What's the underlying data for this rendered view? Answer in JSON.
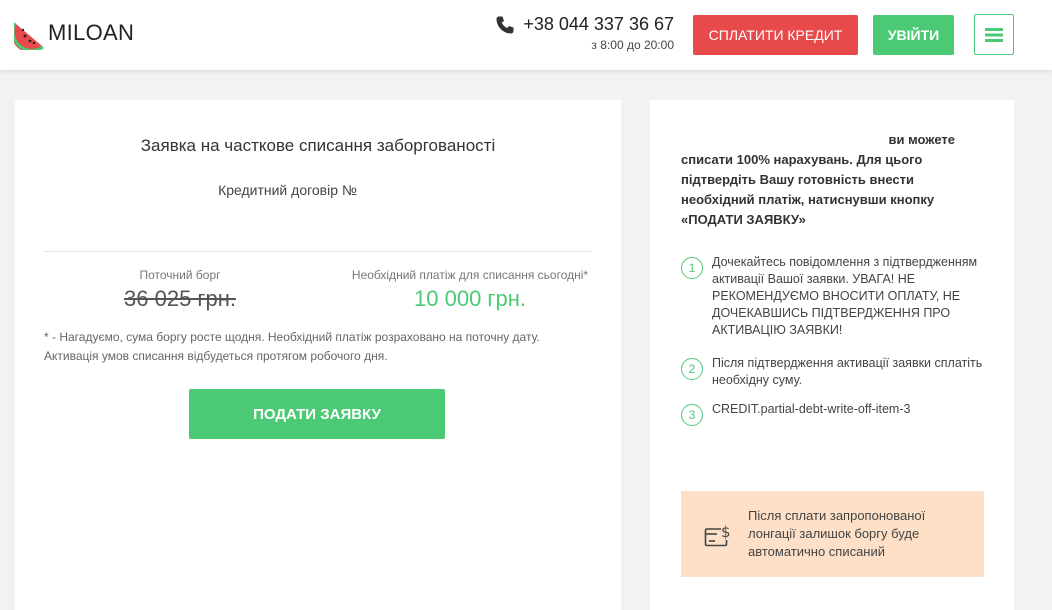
{
  "header": {
    "logo_text": "MILOAN",
    "phone": "+38 044 337 36 67",
    "hours": "з 8:00 до 20:00",
    "pay_credit_label": "СПЛАТИТИ КРЕДИТ",
    "login_label": "УВІЙТИ",
    "colors": {
      "red": "#e8494a",
      "green": "#4cc974"
    }
  },
  "main": {
    "title": "Заявка на часткове списання заборгованості",
    "contract_label": "Кредитний договір №",
    "current_debt_label": "Поточний борг",
    "current_debt_value": "36 025 грн.",
    "required_payment_label": "Необхідний платіж для списання сьогодні*",
    "required_payment_value": "10 000 грн.",
    "note_line1": "* - Нагадуємо, сума боргу росте щодня. Необхідний платіж розраховано на поточну дату.",
    "note_line2": "Активація умов списання відбудеться протягом робочого дня.",
    "submit_label": "ПОДАТИ ЗАЯВКУ"
  },
  "side": {
    "intro_line1": "ви можете",
    "intro_rest": "списати 100% нарахувань. Для цього підтвердіть Вашу готовність внести необхідний платіж, натиснувши кнопку «ПОДАТИ ЗАЯВКУ»",
    "steps": [
      {
        "num": "1",
        "text": "Дочекайтесь повідомлення з підтвердженням активації Вашої заявки. УВАГА! НЕ РЕКОМЕНДУЄМО ВНОСИТИ ОПЛАТУ, НЕ ДОЧЕКАВШИСЬ ПІДТВЕРДЖЕННЯ ПРО АКТИВАЦІЮ ЗАЯВКИ!"
      },
      {
        "num": "2",
        "text": "Після підтвердження активації заявки сплатіть необхідну суму."
      },
      {
        "num": "3",
        "text": "CREDIT.partial-debt-write-off-item-3"
      }
    ],
    "info_text": "Після сплати запропонованої лонгації залишок боргу буде автоматично списаний",
    "info_icon": "money-card-icon"
  }
}
